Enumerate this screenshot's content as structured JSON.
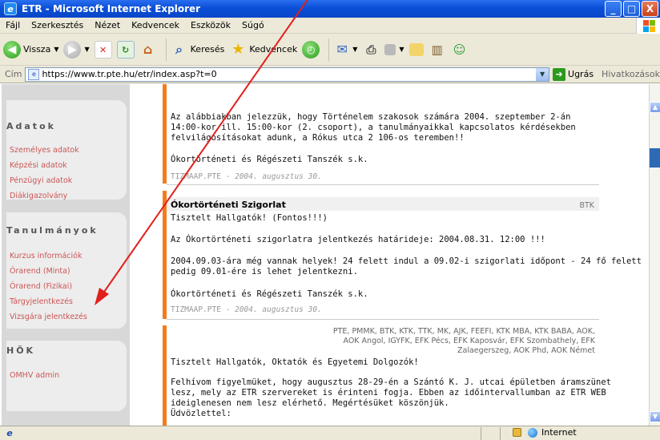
{
  "window": {
    "title": "ETR - Microsoft Internet Explorer",
    "buttons": {
      "minimize": "_",
      "maximize": "□",
      "close": "X"
    }
  },
  "menu": {
    "items": [
      "Fájl",
      "Szerkesztés",
      "Nézet",
      "Kedvencek",
      "Eszközök",
      "Súgó"
    ]
  },
  "toolbar": {
    "back_label": "Vissza",
    "search_label": "Keresés",
    "favorites_label": "Kedvencek"
  },
  "address": {
    "label": "Cím",
    "url": "https://www.tr.pte.hu/etr/index.asp?t=0",
    "go_label": "Ugrás",
    "links_label": "Hivatkozások"
  },
  "sidebar": {
    "sections": [
      {
        "title": "Adatok",
        "items": [
          "Személyes adatok",
          "Képzési adatok",
          "Pénzügyi adatok",
          "Diákigazolvány"
        ]
      },
      {
        "title": "Tanulmányok",
        "items": [
          "Kurzus információk",
          "Órarend (Minta)",
          "Órarend (Fizikai)",
          "Tárgyjelentkezés",
          "Vizsgára jelentkezés"
        ]
      },
      {
        "title": "HÖK",
        "items": [
          "OMHV admin"
        ]
      }
    ]
  },
  "news": {
    "item1": {
      "lines": [
        "Az alábbiakban jelezzük, hogy Történelem szakosok számára 2004. szeptember 2-án",
        "14:00-kor ill. 15:00-kor (2. csoport), a tanulmányaikkal kapcsolatos kérdésekben",
        "felvilágosításokat adunk, a Rókus utca 2 106-os teremben!!"
      ],
      "signature": "Ókortörténeti és Régészeti Tanszék s.k.",
      "author": "TIZMAAP.PTE",
      "date": "2004. augusztus 30."
    },
    "item2": {
      "title": "Ókortörténeti Szigorlat",
      "tag": "BTK",
      "greeting": "Tisztelt Hallgatók! (Fontos!!!)",
      "line1": "Az Ókortörténeti szigorlatra jelentkezés határideje: 2004.08.31. 12:00 !!!",
      "line2a": "2004.09.03-ára még vannak helyek! 24 felett indul a 09.02-i szigorlati időpont - 24 fő felett",
      "line2b": "pedig 09.01-ére is lehet jelentkezni.",
      "signature": "Ókortörténeti és Régészeti Tanszék s.k.",
      "author": "TIZMAAP.PTE",
      "date": "2004. augusztus 30."
    },
    "item3": {
      "targets": [
        "PTE, PMMK, BTK, KTK, TTK, MK, AJK, FEEFI, KTK MBA, KTK BABA, AOK,",
        "AOK Angol, IGYFK, EFK Pécs, EFK Kaposvár, EFK Szombathely, EFK",
        "Zalaegerszeg, AOK Phd, AOK Német"
      ],
      "greeting": "Tisztelt Hallgatók, Oktatók és Egyetemi Dolgozók!",
      "lines": [
        "Felhívom figyelmüket, hogy augusztus 28-29-én a Szántó K. J. utcai épületben áramszünet",
        "lesz, mely az ETR szervereket is érinteni fogja. Ebben az időintervallumban az ETR WEB",
        "ideiglenesen nem lesz elérhető. Megértésüket köszönjük.",
        "Üdvözlettel:"
      ]
    }
  },
  "status": {
    "zone_label": "Internet"
  },
  "colors": {
    "accent_orange": "#f47c1c",
    "sidebar_link": "#cc5555",
    "annotation_arrow": "#e0201c"
  }
}
